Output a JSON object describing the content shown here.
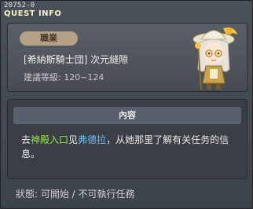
{
  "window": {
    "quest_id": "20752-0",
    "title": "QUEST INFO"
  },
  "quest": {
    "job_label": "職業",
    "name": "[希納斯騎士団] 次元縫隙",
    "level_text": "建議等級: 120~124"
  },
  "content": {
    "header": "內容",
    "text_prefix": "去",
    "location": "神殿入口",
    "text_middle": "见",
    "npc": "弗德拉",
    "text_suffix": "，从她那里了解有关任务的信息。"
  },
  "status": {
    "text": "狀態:  可開始 / 不可執行任務"
  },
  "colors": {
    "location_highlight": "#92e34b",
    "npc_highlight": "#63c4ff"
  }
}
